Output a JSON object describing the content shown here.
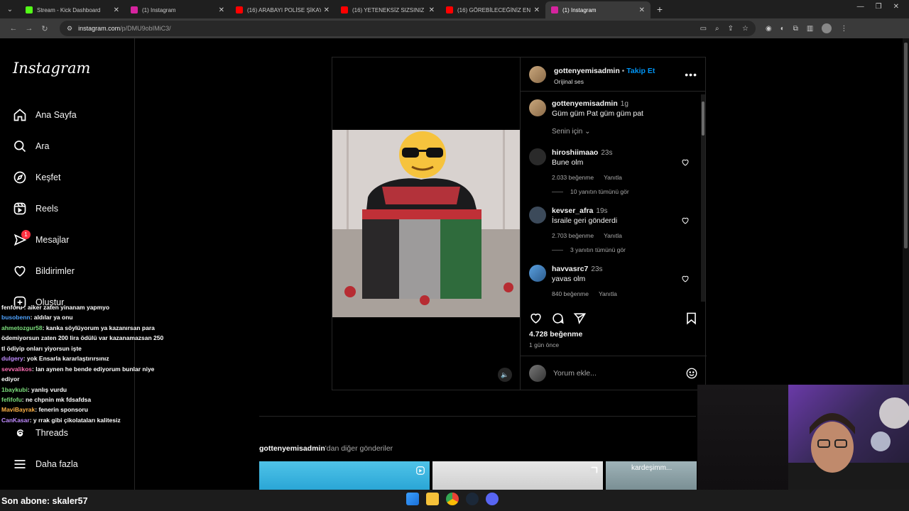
{
  "browser": {
    "tabs": [
      {
        "label": "Stream - Kick Dashboard",
        "color": "#53fc18",
        "active": false
      },
      {
        "label": "(1) Instagram",
        "color": "#d6249f",
        "active": false
      },
      {
        "label": "(16) ARABAYI POLİSE ŞİKAYET E",
        "color": "#ff0000",
        "active": false
      },
      {
        "label": "(16) YETENEKSİZ SIZSINIZ 1. BÖ",
        "color": "#ff0000",
        "active": false
      },
      {
        "label": "(16) GÖREBİLECEĞİNİZ EN ŞEY",
        "color": "#ff0000",
        "active": false
      },
      {
        "label": "(1) Instagram",
        "color": "#d6249f",
        "active": true
      }
    ],
    "new_tab_label": "+",
    "url_domain": "instagram.com",
    "url_path": "/p/DMU9obIMiC3/"
  },
  "sidebar": {
    "logo": "Instagram",
    "items": [
      {
        "label": "Ana Sayfa",
        "icon": "home-icon"
      },
      {
        "label": "Ara",
        "icon": "search-icon"
      },
      {
        "label": "Keşfet",
        "icon": "compass-icon"
      },
      {
        "label": "Reels",
        "icon": "reels-icon"
      },
      {
        "label": "Mesajlar",
        "icon": "messenger-icon",
        "badge": "1"
      },
      {
        "label": "Bildirimler",
        "icon": "heart-icon"
      },
      {
        "label": "Oluştur",
        "icon": "plus-square-icon"
      }
    ],
    "bottom": [
      {
        "label": "Threads",
        "icon": "threads-icon"
      },
      {
        "label": "Daha fazla",
        "icon": "menu-icon"
      }
    ]
  },
  "chat": [
    {
      "user": "",
      "text": "fenforu : aiker zaten yinanam yapmyo",
      "color": "#ffffff"
    },
    {
      "user": "busobenn",
      "text": ": aldılar ya onu",
      "color": "#4fa3ff"
    },
    {
      "user": "ahmetozgur58",
      "text": ": kanka söylüyorum ya kazanırsan para ödemiyorsun zaten 200 lira ödülü var kazanamazsan 250 tl ödiyip onları yiyorsun işte",
      "color": "#7de07d"
    },
    {
      "user": "dulgery",
      "text": ": yok Ensarla kararlaştırırsınız",
      "color": "#c08cff"
    },
    {
      "user": "sevvalikos",
      "text": ": lan aynen he bende ediyorum bunlar niye ediyor",
      "color": "#ff6fb5"
    },
    {
      "user": "1baykubi",
      "text": ": yanlış vurdu",
      "color": "#7de07d"
    },
    {
      "user": "fefifofu",
      "text": ": ne chpnin mk fdsafdsa",
      "color": "#7de07d"
    },
    {
      "user": "MaviBayrak",
      "text": ": fenerin sponsoru",
      "color": "#ffb347"
    },
    {
      "user": "CanKasar",
      "text": ": y rrak gibi çikolataları kalitesiz",
      "color": "#c08cff"
    }
  ],
  "post": {
    "author": "gottenyemisadmin",
    "follow_label": "Takip Et",
    "audio": "Orijinal ses",
    "caption_time": "1g",
    "caption": "Güm güm Pat güm güm pat",
    "for_you": "Senin için",
    "comments": [
      {
        "user": "hiroshiimaao",
        "time": "23s",
        "text": "Bune olm",
        "likes": "2.033 beğenme",
        "reply": "Yanıtla",
        "replies": "10 yanıtın tümünü gör"
      },
      {
        "user": "kevser_afra",
        "time": "19s",
        "text": "İsraile geri gönderdi",
        "likes": "2.703 beğenme",
        "reply": "Yanıtla",
        "replies": "3 yanıtın tümünü gör"
      },
      {
        "user": "havvasrc7",
        "time": "23s",
        "text": "yavas olm",
        "likes": "840 beğenme",
        "reply": "Yanıtla",
        "replies": ""
      }
    ],
    "likes": "4.728 beğenme",
    "posted": "1 gün önce",
    "comment_placeholder": "Yorum ekle..."
  },
  "more_posts": {
    "user": "gottenyemisadmin",
    "suffix": "'dan diğer gönderiler",
    "tile3_label": "kardeşimm..."
  },
  "stream": {
    "last_sub": "Son abone: skaler57"
  }
}
